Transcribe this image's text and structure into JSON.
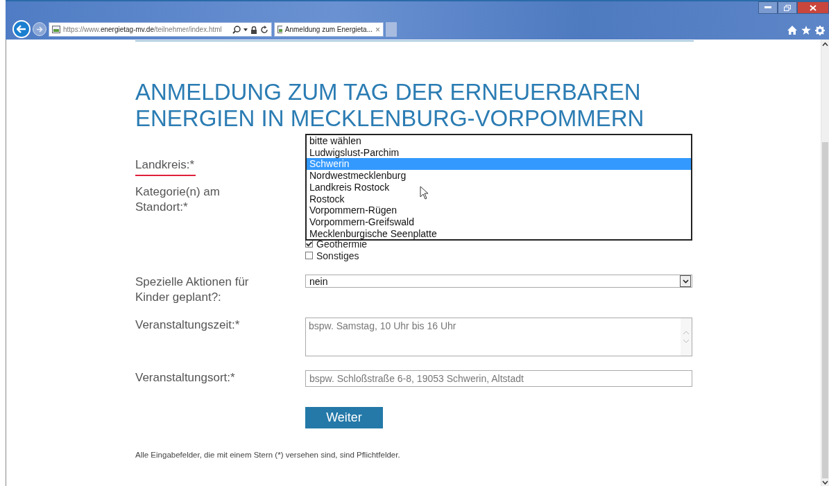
{
  "browser": {
    "address": {
      "prefix": "https://www.",
      "domain": "energietag-mv.de",
      "path": "/teilnehmer/index.html"
    },
    "tabs": [
      {
        "label": "Anmeldung zum Energieta...",
        "selected": true,
        "close": "×"
      }
    ]
  },
  "page": {
    "title": "ANMELDUNG ZUM TAG DER ERNEUERBAREN ENERGIEN IN MECKLENBURG-VORPOMMERN",
    "fields": [
      {
        "kind": "listbox",
        "label": "Landkreis:*",
        "error": true,
        "options": [
          {
            "label": "bitte wählen",
            "selected": false
          },
          {
            "label": "Ludwigslust-Parchim",
            "selected": false
          },
          {
            "label": "Schwerin",
            "selected": true
          },
          {
            "label": "Nordwestmecklenburg",
            "selected": false
          },
          {
            "label": "Landkreis Rostock",
            "selected": false
          },
          {
            "label": "Rostock",
            "selected": false
          },
          {
            "label": "Vorpommern-Rügen",
            "selected": false
          },
          {
            "label": "Vorpommern-Greifswald",
            "selected": false
          },
          {
            "label": "Mecklenburgische Seenplatte",
            "selected": false
          }
        ]
      },
      {
        "kind": "checkboxes",
        "label": "Kategorie(n) am Standort:*",
        "error": false,
        "items": [
          {
            "label": "Geothermie",
            "checked": true
          },
          {
            "label": "Sonstiges",
            "checked": false
          }
        ]
      },
      {
        "kind": "select",
        "label": "Spezielle Aktionen für Kinder geplant?:",
        "error": false,
        "value": "nein"
      },
      {
        "kind": "textarea",
        "label": "Veranstaltungszeit:*",
        "error": false,
        "placeholder": "bspw. Samstag, 10 Uhr bis 16 Uhr"
      },
      {
        "kind": "text",
        "label": "Veranstaltungsort:*",
        "error": false,
        "placeholder": "bspw. Schloßstraße 6-8, 19053 Schwerin, Altstadt"
      }
    ],
    "submit": "Weiter",
    "note": "Alle Eingabefelder, die mit einem Stern (*) versehen sind, sind Pflichtfelder."
  }
}
